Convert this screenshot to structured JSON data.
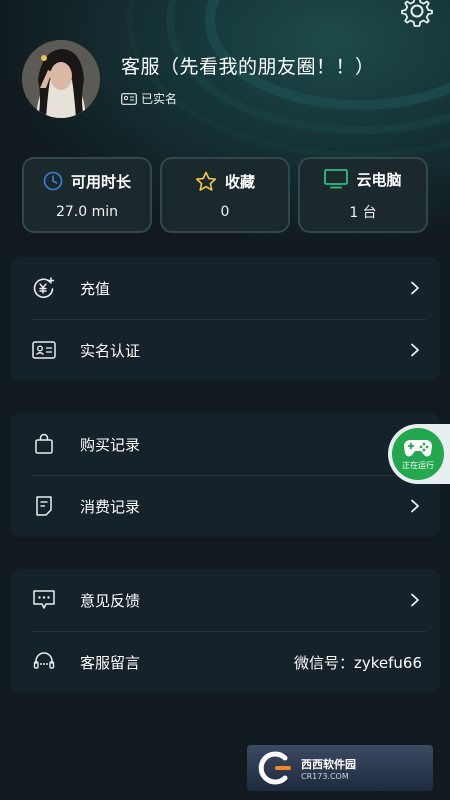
{
  "profile": {
    "name": "客服（先看我的朋友圈！！）",
    "verified_label": "已实名"
  },
  "stats": [
    {
      "label": "可用时长",
      "value": "27.0 min",
      "icon": "clock-icon"
    },
    {
      "label": "收藏",
      "value": "0",
      "icon": "star-icon"
    },
    {
      "label": "云电脑",
      "value": "1 台",
      "icon": "monitor-icon"
    }
  ],
  "menu1": {
    "recharge": "充值",
    "realname": "实名认证"
  },
  "menu2": {
    "purchase": "购买记录",
    "consume": "消费记录"
  },
  "menu3": {
    "feedback": "意见反馈",
    "service": "客服留言",
    "wechat": "微信号：zykefu66"
  },
  "floating": {
    "running_label": "正在运行"
  },
  "watermark": {
    "brand": "西西软件园",
    "site": "CR173.COM"
  },
  "colors": {
    "accent_green": "#23a74f",
    "clock_blue": "#3d7fd9",
    "star_yellow": "#f2c94c",
    "monitor_green": "#26c281"
  }
}
